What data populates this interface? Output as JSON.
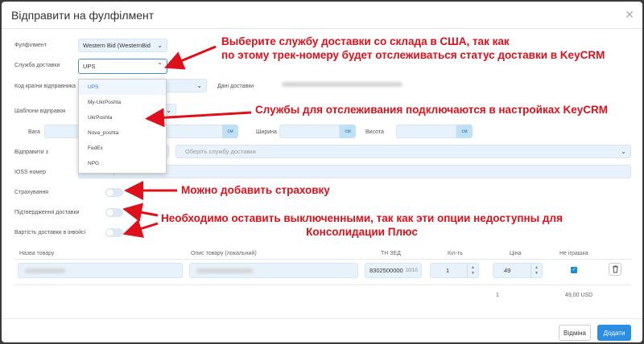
{
  "modal": {
    "title": "Відправити на фулфілмент"
  },
  "form": {
    "fulfillment_label": "Фулфілмент",
    "fulfillment_value": "Western Bid (WesternBid",
    "delivery_service_label": "Служба доставки",
    "delivery_service_value": "UPS",
    "sender_country_label": "Код країни відправника",
    "delivery_data_label": "Дані доставки",
    "templates_label": "Шаблони відправок",
    "weight_label": "Вага",
    "width_label": "Ширина",
    "height_label": "Висота",
    "unit": "см",
    "send_from_label": "Відправити з",
    "send_from_placeholder": "Оберіть службу доставки",
    "ioss_label": "IOSS номер",
    "ioss_placeholder": "IOSS номер",
    "insurance_label": "Страхування",
    "confirmation_label": "Підтвердження доставки",
    "invoice_cost_label": "Вартість доставки в інвойсі"
  },
  "dropdown": {
    "options": [
      "UPS",
      "My-UkrPoshta",
      "UkrPoshta",
      "Nova_poshta",
      "FedEx",
      "NPG"
    ]
  },
  "table": {
    "headers": {
      "name": "Назва товару",
      "description": "Опис товару (локальний)",
      "hs_code": "ТН ЗЕД",
      "qty": "Кіл-ть",
      "price": "Ціна",
      "not_toy": "Не іграшка"
    },
    "row": {
      "hs_code": "8302500000",
      "hs_counter": "10/10",
      "qty": "1",
      "price": "49"
    },
    "totals": {
      "qty": "1",
      "sum": "49,00 USD"
    }
  },
  "footer": {
    "cancel_label": "Відміна",
    "add_label": "Додати"
  },
  "annotations": {
    "a1_line1": "Выберите службу доставки со склада в США, так как",
    "a1_line2": "по этому трек-номеру будет отслеживаться статус доставки в KeyCRM",
    "a2": "Службы для отслеживания подключаются в настройках KeyCRM",
    "a3": "Можно добавить страховку",
    "a4_line1": "Необходимо оставить выключенными, так как эти опции недоступны для",
    "a4_line2": "Консолидации Плюс"
  },
  "colors": {
    "annotation": "#e0101a",
    "primary": "#2b8ee3",
    "field_bg": "#e8f2fb"
  },
  "icons": {
    "close": "close-icon",
    "chevron": "chevron-down-icon",
    "trash": "trash-icon",
    "check": "check-icon"
  }
}
